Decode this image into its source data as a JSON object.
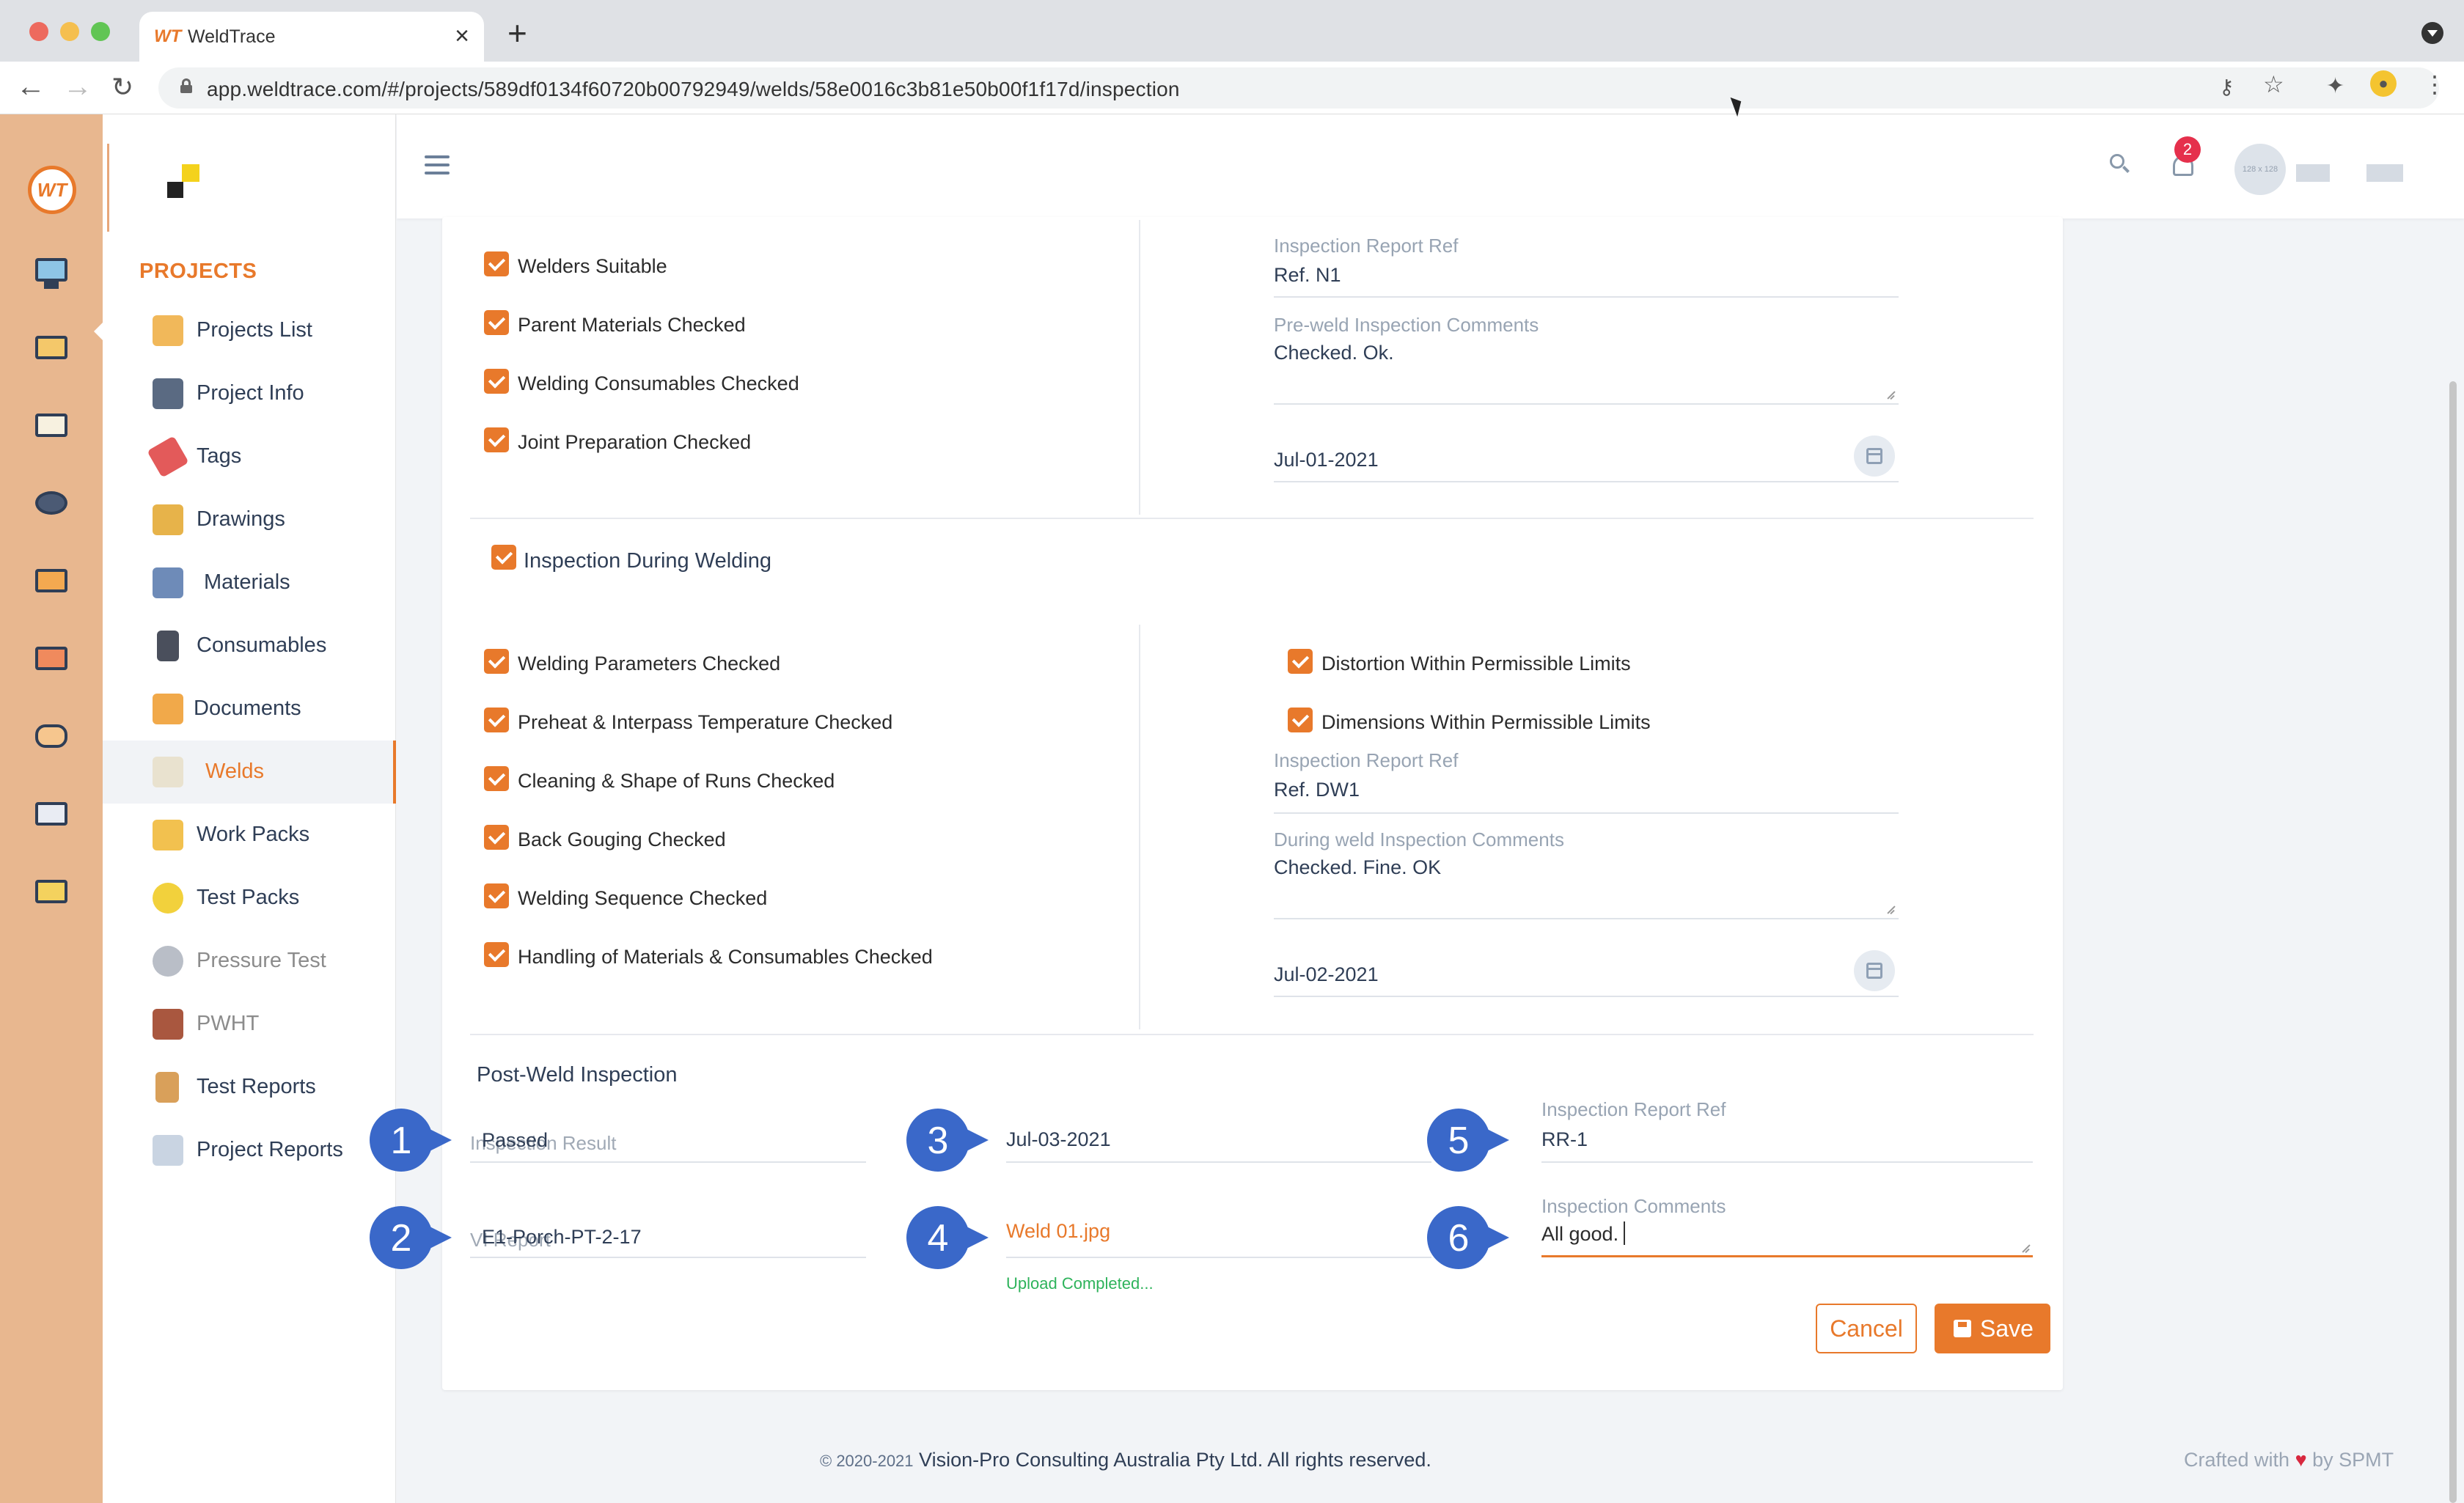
{
  "browser": {
    "tab_title": "WeldTrace",
    "tab_logo": "WT",
    "url": "app.weldtrace.com/#/projects/589df0134f60720b00792949/welds/58e0016c3b81e50b00f1f17d/inspection"
  },
  "app_logo": "WT",
  "sidebar": {
    "heading": "PROJECTS",
    "items": [
      {
        "label": "Projects List"
      },
      {
        "label": "Project Info"
      },
      {
        "label": "Tags"
      },
      {
        "label": "Drawings"
      },
      {
        "label": "Materials"
      },
      {
        "label": "Consumables"
      },
      {
        "label": "Documents"
      },
      {
        "label": "Welds"
      },
      {
        "label": "Work Packs"
      },
      {
        "label": "Test Packs"
      },
      {
        "label": "Pressure Test"
      },
      {
        "label": "PWHT"
      },
      {
        "label": "Test Reports"
      },
      {
        "label": "Project Reports"
      }
    ]
  },
  "header": {
    "notification_count": "2",
    "avatar_text": "128 x 128"
  },
  "pre_weld": {
    "checks": [
      "Welders Suitable",
      "Parent Materials Checked",
      "Welding Consumables Checked",
      "Joint Preparation Checked"
    ],
    "report_ref_label": "Inspection Report Ref",
    "report_ref": "Ref. N1",
    "comments_label": "Pre-weld Inspection Comments",
    "comments": "Checked. Ok.",
    "date": "Jul-01-2021"
  },
  "during_weld": {
    "title": "Inspection During Welding",
    "checks_left": [
      "Welding Parameters Checked",
      "Preheat & Interpass Temperature Checked",
      "Cleaning & Shape of Runs Checked",
      "Back Gouging Checked",
      "Welding Sequence Checked",
      "Handling of Materials & Consumables Checked"
    ],
    "checks_right": [
      "Distortion Within Permissible Limits",
      "Dimensions Within Permissible Limits"
    ],
    "report_ref_label": "Inspection Report Ref",
    "report_ref": "Ref. DW1",
    "comments_label": "During weld Inspection Comments",
    "comments": "Checked. Fine. OK",
    "date": "Jul-02-2021"
  },
  "post_weld": {
    "title": "Post-Weld Inspection",
    "result_value": "Passed",
    "result_label": "Inspection Result",
    "vi_value": "E1-Porch-PT-2-17",
    "vi_label": "VI Report",
    "date": "Jul-03-2021",
    "file_name": "Weld 01.jpg",
    "upload_status": "Upload Completed...",
    "report_ref_label": "Inspection Report Ref",
    "report_ref": "RR-1",
    "comments_label": "Inspection Comments",
    "comments": "All good."
  },
  "markers": [
    "1",
    "2",
    "3",
    "4",
    "5",
    "6"
  ],
  "buttons": {
    "cancel": "Cancel",
    "save": "Save"
  },
  "footer": {
    "copyright_symbol": "© 2020-2021",
    "copyright": "Vision-Pro Consulting Australia Pty Ltd. All rights reserved.",
    "crafted": "Crafted with",
    "by": "by SPMT"
  },
  "colors": {
    "accent": "#e8792b",
    "marker": "#3a68c9",
    "iconbar": "#e8b78f",
    "success": "#2eb35b"
  }
}
